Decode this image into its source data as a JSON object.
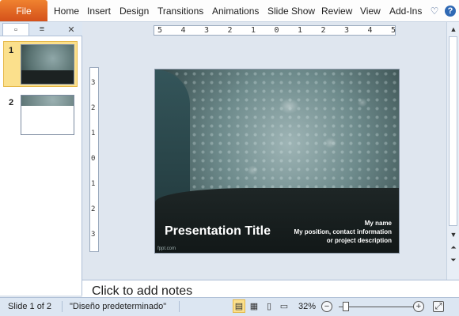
{
  "ribbon": {
    "file_label": "File",
    "tabs": [
      "Home",
      "Insert",
      "Design",
      "Transitions",
      "Animations",
      "Slide Show",
      "Review",
      "View",
      "Add-Ins"
    ],
    "help_label": "?",
    "icons": [
      "heart-icon",
      "help-icon"
    ]
  },
  "panel": {
    "tab_icons": [
      "slides-tab-icon",
      "outline-tab-icon"
    ],
    "close_label": "✕",
    "thumbnails": [
      {
        "number": "1",
        "selected": true
      },
      {
        "number": "2",
        "selected": false
      }
    ]
  },
  "ruler": {
    "horizontal_ticks": [
      "5",
      "4",
      "3",
      "2",
      "1",
      "0",
      "1",
      "2",
      "3",
      "4",
      "5"
    ],
    "vertical_ticks": [
      "3",
      "2",
      "1",
      "0",
      "1",
      "2",
      "3"
    ]
  },
  "slide": {
    "title": "Presentation Title",
    "info_line1": "My name",
    "info_line2": "My position, contact information",
    "info_line3": "or project description",
    "brand": "fppt.com"
  },
  "notes": {
    "placeholder": "Click to add notes"
  },
  "status": {
    "slide_info": "Slide 1 of 2",
    "theme": "\"Diseño predeterminado\"",
    "zoom": "32%",
    "zoom_level_percent": 32,
    "view_icons": [
      "normal-view-icon",
      "slide-sorter-icon",
      "reading-view-icon",
      "slideshow-icon"
    ]
  },
  "colors": {
    "file_tab": "#d5511a",
    "accent_blue": "#2f69b4",
    "selection": "#fbe08c"
  }
}
